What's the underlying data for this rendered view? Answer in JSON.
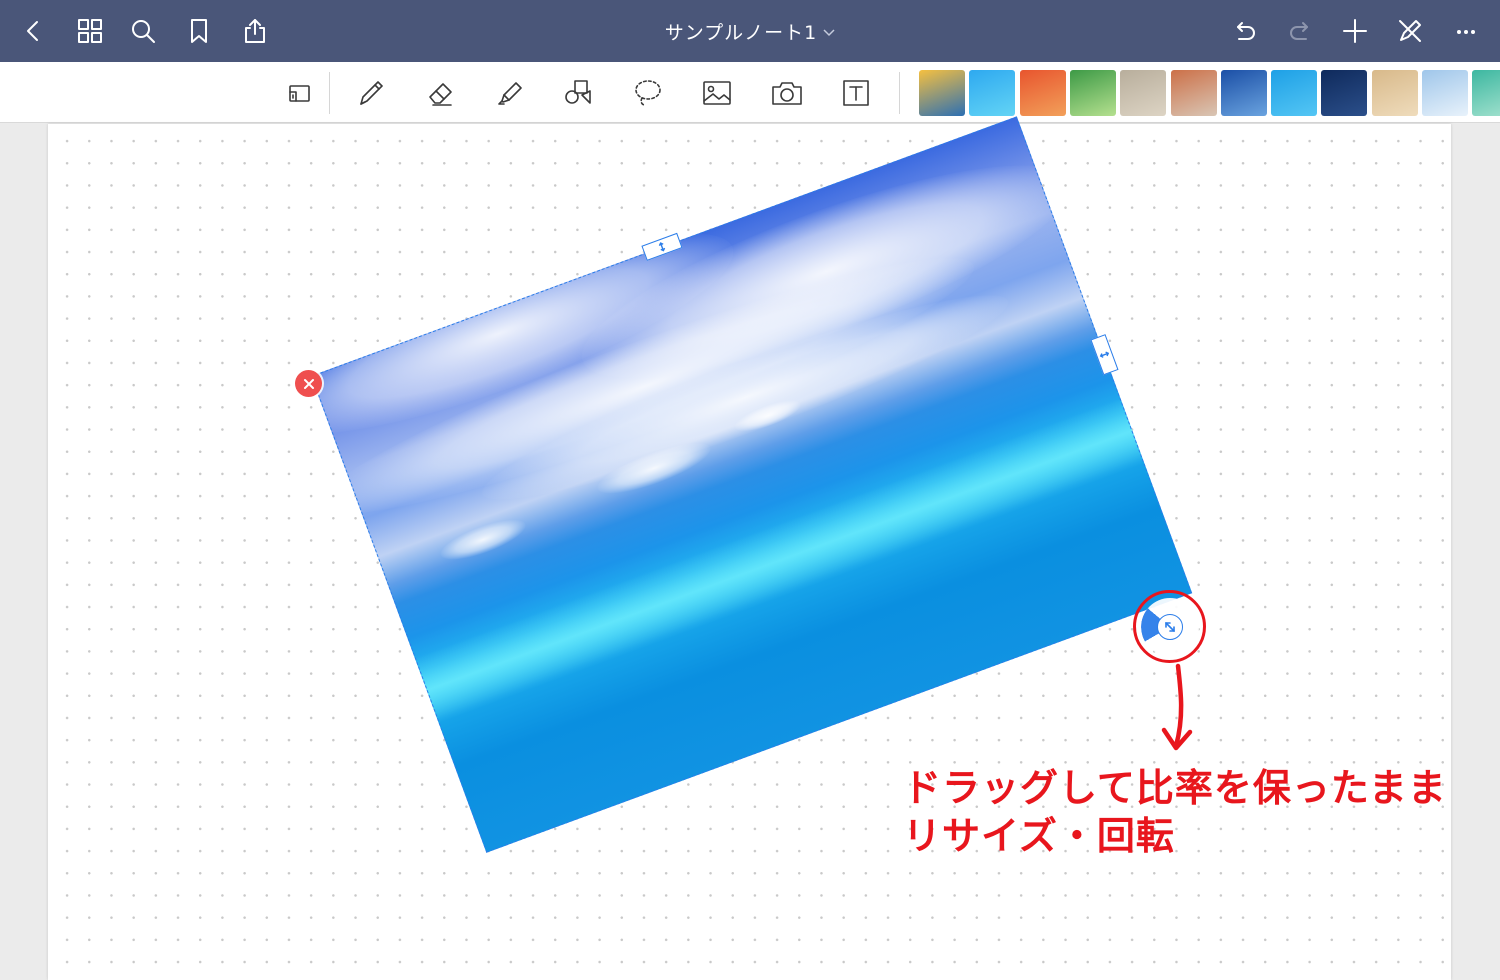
{
  "header": {
    "title": "サンプルノート1",
    "buttons": [
      "back-icon",
      "grid-icon",
      "search-icon",
      "bookmark-icon",
      "share-icon",
      "undo-icon",
      "redo-icon",
      "add-icon",
      "pen-off-icon",
      "more-icon"
    ]
  },
  "toolbar": {
    "tools": [
      "view-mode-icon",
      "pen-icon",
      "eraser-icon",
      "highlighter-icon",
      "shapes-icon",
      "lasso-icon",
      "image-icon",
      "camera-icon",
      "text-tool-icon"
    ],
    "stickers": [
      {
        "name": "sunset-sea",
        "colors": [
          "#f6c040",
          "#2c6fb3"
        ]
      },
      {
        "name": "tropical-sea",
        "colors": [
          "#2ea9f0",
          "#63d4f5"
        ]
      },
      {
        "name": "red-leaves",
        "colors": [
          "#e8552e",
          "#f2a05a"
        ]
      },
      {
        "name": "green-leaves",
        "colors": [
          "#3d9a46",
          "#b5e08f"
        ]
      },
      {
        "name": "stone-wall",
        "colors": [
          "#b8ae9c",
          "#ddd4c4"
        ]
      },
      {
        "name": "autumn-branches",
        "colors": [
          "#cc7048",
          "#d9c6b5"
        ]
      },
      {
        "name": "blue-lake",
        "colors": [
          "#1b4fa6",
          "#6aa3df"
        ]
      },
      {
        "name": "water-surface",
        "colors": [
          "#1ea0e6",
          "#54c6f4"
        ]
      },
      {
        "name": "night-sky",
        "colors": [
          "#0f2a5c",
          "#2b4f8a"
        ]
      },
      {
        "name": "wood-grain",
        "colors": [
          "#d8b98a",
          "#efdcbc"
        ]
      },
      {
        "name": "snow-tree",
        "colors": [
          "#9fc6ea",
          "#e8f2fb"
        ]
      },
      {
        "name": "green-water",
        "colors": [
          "#3cb7a0",
          "#a7e3d0"
        ]
      }
    ]
  },
  "selection": {
    "rotation_deg": -20.2,
    "delete_icon": "close-icon",
    "resize_rotate_icon": "resize-rotate-icon"
  },
  "annotation": {
    "line1": "ドラッグして比率を保ったまま",
    "line2": "リサイズ・回転",
    "color": "#e8161d"
  },
  "colors": {
    "header_bg": "#4a5679",
    "selection_blue": "#2b7de9",
    "delete_red": "#ef4f4f"
  }
}
